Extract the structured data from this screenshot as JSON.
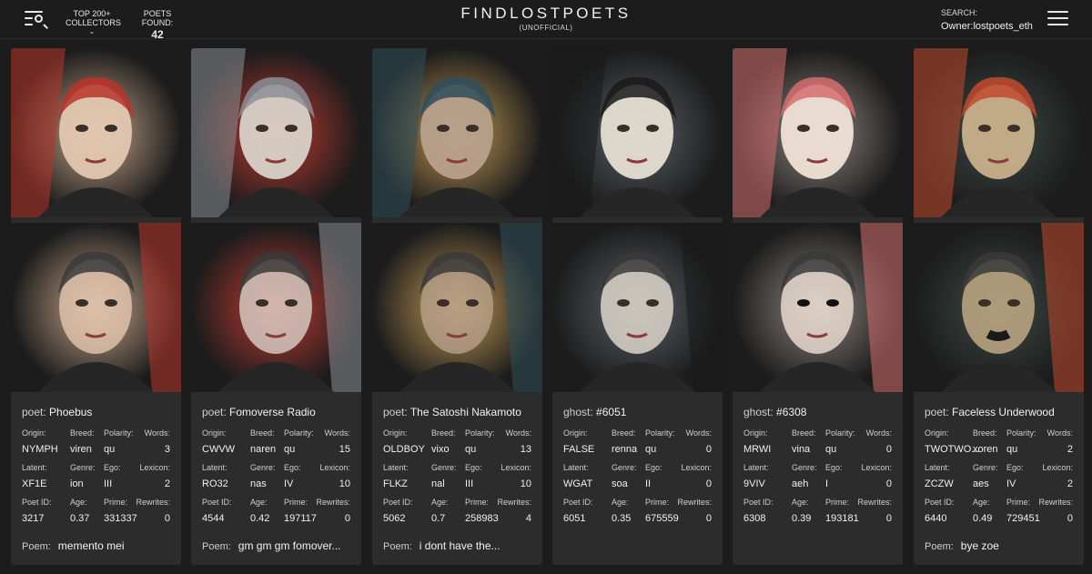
{
  "header": {
    "collectors_label_1": "TOP 200+",
    "collectors_label_2": "COLLECTORS",
    "poets_found_label": "POETS FOUND:",
    "poets_found_count": "42",
    "brand_title": "FINDLOSTPOETS",
    "brand_subtitle": "(UNOFFICIAL)",
    "search_label": "SEARCH:",
    "search_value": "Owner:lostpoets_eth"
  },
  "labels": {
    "origin": "Origin:",
    "breed": "Breed:",
    "polarity": "Polarity:",
    "words": "Words:",
    "latent": "Latent:",
    "genre": "Genre:",
    "ego": "Ego:",
    "lexicon": "Lexicon:",
    "poet_id": "Poet ID:",
    "age": "Age:",
    "prime": "Prime:",
    "rewrites": "Rewrites:",
    "poem": "Poem:"
  },
  "poets": [
    {
      "kind": "poet:",
      "name": "Phoebus",
      "origin": "NYMPH",
      "breed": "viren",
      "polarity": "qu",
      "words": "3",
      "latent": "XF1E",
      "genre": "ion",
      "ego": "III",
      "lexicon": "2",
      "poet_id": "3217",
      "age": "0.37",
      "prime": "331337",
      "rewrites": "0",
      "poem": "memento mei",
      "bg": "#c7a58a",
      "accent": "#b8342c",
      "face": "#e3c7b0"
    },
    {
      "kind": "poet:",
      "name": "Fomoverse Radio",
      "origin": "CWVW",
      "breed": "naren",
      "polarity": "qu",
      "words": "15",
      "latent": "RO32",
      "genre": "nas",
      "ego": "IV",
      "lexicon": "10",
      "poet_id": "4544",
      "age": "0.42",
      "prime": "197117",
      "rewrites": "0",
      "poem": "gm gm gm fomover...",
      "bg": "#c03a32",
      "accent": "#8b8f96",
      "face": "#d8d2c8"
    },
    {
      "kind": "poet:",
      "name": "The Satoshi Nakamoto",
      "origin": "OLDBOY",
      "breed": "vixo",
      "polarity": "qu",
      "words": "13",
      "latent": "FLKZ",
      "genre": "nal",
      "ego": "III",
      "lexicon": "10",
      "poet_id": "5062",
      "age": "0.7",
      "prime": "258983",
      "rewrites": "4",
      "poem": "i dont have the...",
      "bg": "#c39a55",
      "accent": "#2f4e5a",
      "face": "#b8a08c"
    },
    {
      "kind": "ghost:",
      "name": "#6051",
      "origin": "FALSE",
      "breed": "renna",
      "polarity": "qu",
      "words": "0",
      "latent": "WGAT",
      "genre": "soa",
      "ego": "II",
      "lexicon": "0",
      "poet_id": "6051",
      "age": "0.35",
      "prime": "675559",
      "rewrites": "0",
      "poem": "",
      "bg": "#5a6068",
      "accent": "#1a1a1a",
      "face": "#e6ded2"
    },
    {
      "kind": "ghost:",
      "name": "#6308",
      "origin": "MRWI",
      "breed": "vina",
      "polarity": "qu",
      "words": "0",
      "latent": "9VIV",
      "genre": "aeh",
      "ego": "I",
      "lexicon": "0",
      "poet_id": "6308",
      "age": "0.39",
      "prime": "193181",
      "rewrites": "0",
      "poem": "",
      "bg": "#8f8580",
      "accent": "#d66d6d",
      "face": "#efe1d6"
    },
    {
      "kind": "poet:",
      "name": "Faceless Underwood",
      "origin": "TWOTWO...",
      "breed": "xoren",
      "polarity": "qu",
      "words": "2",
      "latent": "ZCZW",
      "genre": "aes",
      "ego": "IV",
      "lexicon": "2",
      "poet_id": "6440",
      "age": "0.49",
      "prime": "729451",
      "rewrites": "0",
      "poem": "bye zoe",
      "bg": "#3d4a44",
      "accent": "#c24a2e",
      "face": "#c9b08a"
    }
  ]
}
